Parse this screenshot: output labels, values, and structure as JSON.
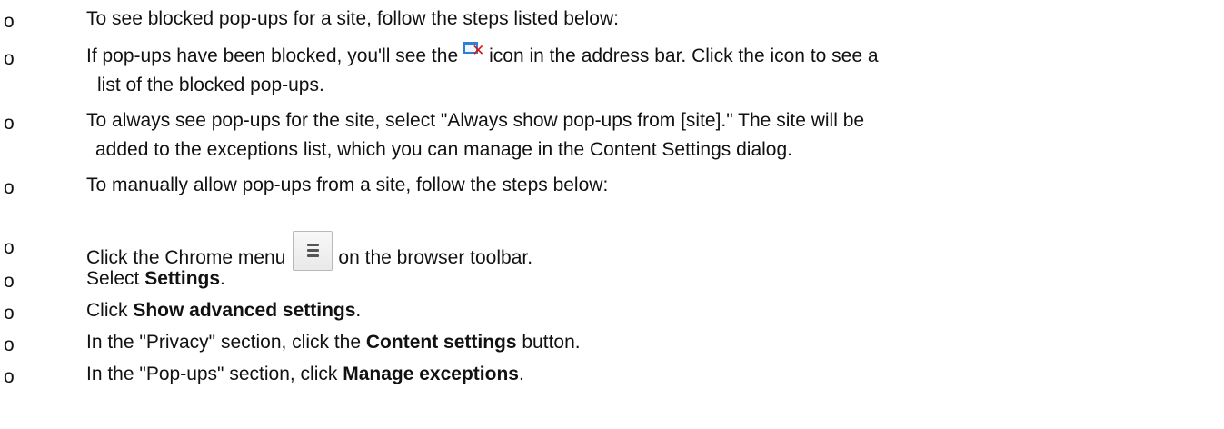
{
  "bullet": "o",
  "items": [
    {
      "text": "To see blocked pop-ups for a site, follow the steps listed below:"
    },
    {
      "before_icon": "If pop-ups have been blocked, you'll see the",
      "icon": "popup-blocked-icon",
      "after_icon": "icon in the address bar. Click the icon to see a",
      "continuation": "list of the blocked pop-ups."
    },
    {
      "text": "To always see pop-ups for the site, select \"Always show pop-ups from [site].\" The site will be",
      "continuation": "added to the exceptions list, which you can manage in the Content Settings dialog."
    },
    {
      "text": "To manually allow pop-ups from a site, follow the steps below:"
    },
    {
      "before_icon": "Click the Chrome menu",
      "icon": "chrome-menu-icon",
      "after_icon": "on the browser toolbar."
    },
    {
      "prefix": "Select ",
      "bold": "Settings",
      "suffix": "."
    },
    {
      "prefix": "Click ",
      "bold": "Show advanced settings",
      "suffix": "."
    },
    {
      "prefix": "In the \"Privacy\" section, click the ",
      "bold": "Content settings",
      "suffix": " button."
    },
    {
      "prefix": "In the \"Pop-ups\" section, click ",
      "bold": "Manage exceptions",
      "suffix": "."
    }
  ]
}
